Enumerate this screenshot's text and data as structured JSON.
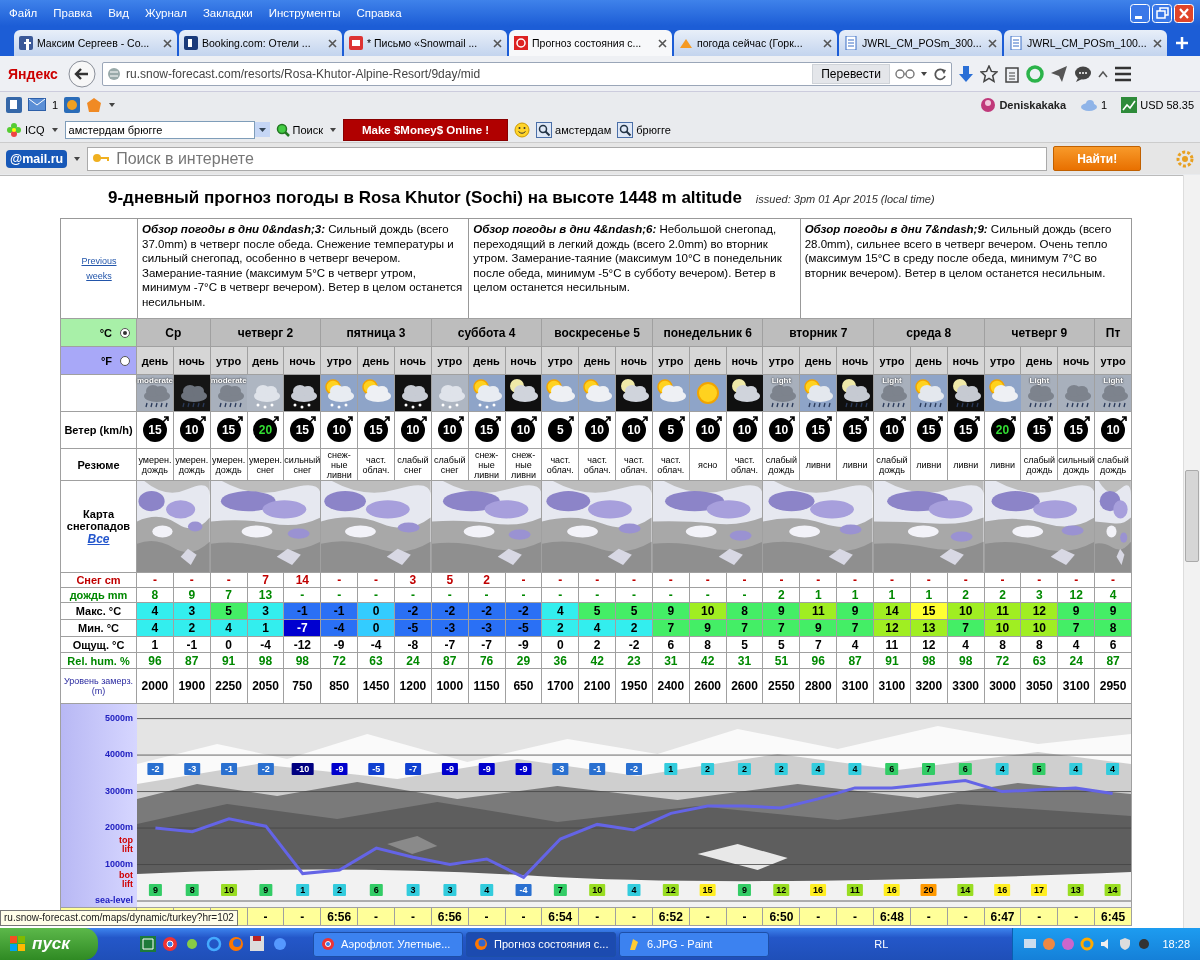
{
  "window": {
    "menu": [
      "Файл",
      "Правка",
      "Вид",
      "Журнал",
      "Закладки",
      "Инструменты",
      "Справка"
    ]
  },
  "tabs": [
    {
      "label": "Максим Сергеев - Co...",
      "selected": false
    },
    {
      "label": "Booking.com: Отели ...",
      "selected": false
    },
    {
      "label": "* Письмо «Snowmail ...",
      "selected": false
    },
    {
      "label": "Прогноз состояния с...",
      "selected": true
    },
    {
      "label": "погода сейчас (Горк...",
      "selected": false
    },
    {
      "label": "JWRL_CM_POSm_300...",
      "selected": false
    },
    {
      "label": "JWRL_CM_POSm_100...",
      "selected": false
    }
  ],
  "address_bar": {
    "logo": "Яндекс",
    "url": "ru.snow-forecast.com/resorts/Rosa-Khutor-Alpine-Resort/9day/mid",
    "translate_button": "Перевести"
  },
  "toolbar": {
    "mail_count": "1",
    "user": "Deniskakaka",
    "cloud_count": "1",
    "currency": "USD 58.35"
  },
  "search_toolbar": {
    "icq": "ICQ",
    "query": "амстердам брюгге",
    "search_button": "Поиск",
    "ad_button": "Make $Money$ Online !",
    "links": [
      "амстердам",
      "брюгге"
    ]
  },
  "mail_bar": {
    "logo": "@mail.ru",
    "placeholder": "Поиск в интернете",
    "button": "Найти!"
  },
  "page": {
    "title": "9-дневный прогноз погоды в Rosa Khutor (Sochi) на высоте 1448 m altitude",
    "issued": "issued: 3pm 01 Apr 2015 (local time)",
    "previous_link": "Previous weeks",
    "summaries": [
      "**Обзор погоды в дни 0&ndash;3:** Сильный дождь (всего 37.0mm) в четверг после обеда. Снежение температуры и сильный снегопад, особенно в четверг вечером. Замерание-таяние (максимум 5°C в четверг утром, минимум -7°C в четверг вечером). Ветер в целом останется несильным.",
      "**Обзор погоды в дни 4&ndash;6:** Небольшой снегопад, переходящий в легкий дождь (всего 2.0mm) во вторник утром. Замерание-таяние (максимум 10°C в понедельник после обеда, минимум -5°C в субботу вечером). Ветер в целом останется несильным.",
      "**Обзор погоды в дни 7&ndash;9:** Сильный дождь (всего 28.0mm), сильнее всего в четверг вечером. Очень тепло (максимум 15°C в среду после обеда, минимум 7°C во вторник вечером). Ветер в целом останется несильным."
    ]
  },
  "forecast": {
    "units": [
      {
        "label": "°C",
        "selected": true
      },
      {
        "label": "°F",
        "selected": false
      }
    ],
    "days": [
      {
        "name": "Ср",
        "periods": [
          "день",
          "ночь"
        ]
      },
      {
        "name": "четверг 2",
        "periods": [
          "утро",
          "день",
          "ночь"
        ]
      },
      {
        "name": "пятница 3",
        "periods": [
          "утро",
          "день",
          "ночь"
        ]
      },
      {
        "name": "суббота 4",
        "periods": [
          "утро",
          "день",
          "ночь"
        ]
      },
      {
        "name": "воскресенье 5",
        "periods": [
          "утро",
          "день",
          "ночь"
        ]
      },
      {
        "name": "понедельник 6",
        "periods": [
          "утро",
          "день",
          "ночь"
        ]
      },
      {
        "name": "вторник 7",
        "periods": [
          "утро",
          "день",
          "ночь"
        ]
      },
      {
        "name": "среда 8",
        "periods": [
          "утро",
          "день",
          "ночь"
        ]
      },
      {
        "name": "четверг 9",
        "periods": [
          "утро",
          "день",
          "ночь"
        ]
      },
      {
        "name": "Пт",
        "periods": [
          "утро"
        ]
      }
    ],
    "weather_icons": [
      {
        "kind": "rain",
        "caption": "moderate"
      },
      {
        "kind": "rain-night"
      },
      {
        "kind": "rain",
        "caption": "moderate"
      },
      {
        "kind": "snow"
      },
      {
        "kind": "snow-night"
      },
      {
        "kind": "sun-cloud-snow"
      },
      {
        "kind": "sun-cloud"
      },
      {
        "kind": "snow-night"
      },
      {
        "kind": "snow"
      },
      {
        "kind": "sun-cloud-snow"
      },
      {
        "kind": "moon-cloud"
      },
      {
        "kind": "sun-cloud"
      },
      {
        "kind": "sun-cloud"
      },
      {
        "kind": "moon-cloud"
      },
      {
        "kind": "sun-cloud"
      },
      {
        "kind": "sun"
      },
      {
        "kind": "moon-cloud"
      },
      {
        "kind": "rain",
        "caption": "Light"
      },
      {
        "kind": "sun-cloud-rain"
      },
      {
        "kind": "moon-rain"
      },
      {
        "kind": "rain",
        "caption": "Light"
      },
      {
        "kind": "sun-cloud-rain"
      },
      {
        "kind": "moon-rain"
      },
      {
        "kind": "sun-cloud"
      },
      {
        "kind": "rain",
        "caption": "Light"
      },
      {
        "kind": "rain"
      },
      {
        "kind": "rain",
        "caption": "Light"
      }
    ],
    "wind": {
      "label": "Ветер (km/h)",
      "values": [
        {
          "speed": "15",
          "strong": false
        },
        {
          "speed": "10",
          "strong": false
        },
        {
          "speed": "15",
          "strong": false
        },
        {
          "speed": "20",
          "strong": true
        },
        {
          "speed": "15",
          "strong": false
        },
        {
          "speed": "10",
          "strong": false
        },
        {
          "speed": "15",
          "strong": false
        },
        {
          "speed": "10",
          "strong": false
        },
        {
          "speed": "10",
          "strong": false
        },
        {
          "speed": "15",
          "strong": false
        },
        {
          "speed": "10",
          "strong": false
        },
        {
          "speed": "5",
          "strong": false
        },
        {
          "speed": "10",
          "strong": false
        },
        {
          "speed": "10",
          "strong": false
        },
        {
          "speed": "5",
          "strong": false
        },
        {
          "speed": "10",
          "strong": false
        },
        {
          "speed": "10",
          "strong": false
        },
        {
          "speed": "10",
          "strong": false
        },
        {
          "speed": "15",
          "strong": false
        },
        {
          "speed": "15",
          "strong": false
        },
        {
          "speed": "10",
          "strong": false
        },
        {
          "speed": "15",
          "strong": false
        },
        {
          "speed": "15",
          "strong": false
        },
        {
          "speed": "20",
          "strong": true
        },
        {
          "speed": "15",
          "strong": false
        },
        {
          "speed": "15",
          "strong": false
        },
        {
          "speed": "10",
          "strong": false
        }
      ]
    },
    "summary": {
      "label": "Резюме",
      "values": [
        "умерен. дождь",
        "умерен. дождь",
        "умерен. дождь",
        "умерен. снег",
        "сильный снег",
        "снеж-ные ливни",
        "част. облач.",
        "слабый снег",
        "слабый снег",
        "снеж-ные ливни",
        "снеж-ные ливни",
        "част. облач.",
        "част. облач.",
        "част. облач.",
        "част. облач.",
        "ясно",
        "част. облач.",
        "слабый дождь",
        "ливни",
        "ливни",
        "слабый дождь",
        "ливни",
        "ливни",
        "ливни",
        "слабый дождь",
        "сильный дождь",
        "слабый дождь"
      ]
    },
    "snow_maps": {
      "label": "Карта снегопадов",
      "link": "Все"
    },
    "snow": {
      "label": "Снег cm",
      "values": [
        "-",
        "-",
        "-",
        "7",
        "14",
        "-",
        "-",
        "3",
        "5",
        "2",
        "-",
        "-",
        "-",
        "-",
        "-",
        "-",
        "-",
        "-",
        "-",
        "-",
        "-",
        "-",
        "-",
        "-",
        "-",
        "-",
        "-"
      ]
    },
    "rain": {
      "label": "дождь mm",
      "values": [
        "8",
        "9",
        "7",
        "13",
        "-",
        "-",
        "-",
        "-",
        "-",
        "-",
        "-",
        "-",
        "-",
        "-",
        "-",
        "-",
        "-",
        "2",
        "1",
        "1",
        "1",
        "1",
        "2",
        "2",
        "3",
        "12",
        "4"
      ]
    },
    "max_temp": {
      "label": "Макс. °C",
      "values": [
        {
          "value": "4",
          "color": "#33eeee"
        },
        {
          "value": "3",
          "color": "#33eeee"
        },
        {
          "value": "5",
          "color": "#44ee66"
        },
        {
          "value": "3",
          "color": "#33eeee"
        },
        {
          "value": "-1",
          "color": "#2a70f5"
        },
        {
          "value": "-1",
          "color": "#2a70f5"
        },
        {
          "value": "0",
          "color": "#33ccff"
        },
        {
          "value": "-2",
          "color": "#2a70f5"
        },
        {
          "value": "-2",
          "color": "#2a70f5"
        },
        {
          "value": "-2",
          "color": "#2a70f5"
        },
        {
          "value": "-2",
          "color": "#2a70f5"
        },
        {
          "value": "4",
          "color": "#33eeee"
        },
        {
          "value": "5",
          "color": "#44ee66"
        },
        {
          "value": "5",
          "color": "#44ee66"
        },
        {
          "value": "9",
          "color": "#44ee66"
        },
        {
          "value": "10",
          "color": "#a0ee22"
        },
        {
          "value": "8",
          "color": "#44ee66"
        },
        {
          "value": "9",
          "color": "#44ee66"
        },
        {
          "value": "11",
          "color": "#a0ee22"
        },
        {
          "value": "9",
          "color": "#44ee66"
        },
        {
          "value": "14",
          "color": "#a0ee22"
        },
        {
          "value": "15",
          "color": "#ffff33"
        },
        {
          "value": "10",
          "color": "#a0ee22"
        },
        {
          "value": "11",
          "color": "#a0ee22"
        },
        {
          "value": "12",
          "color": "#a0ee22"
        },
        {
          "value": "9",
          "color": "#44ee66"
        },
        {
          "value": "9",
          "color": "#44ee66"
        }
      ]
    },
    "min_temp": {
      "label": "Мин. °C",
      "values": [
        {
          "value": "4",
          "color": "#33eeee"
        },
        {
          "value": "2",
          "color": "#33eeee"
        },
        {
          "value": "4",
          "color": "#33eeee"
        },
        {
          "value": "1",
          "color": "#33eeee"
        },
        {
          "value": "-7",
          "color": "#0000d0"
        },
        {
          "value": "-4",
          "color": "#2a70f5"
        },
        {
          "value": "0",
          "color": "#33ccff"
        },
        {
          "value": "-5",
          "color": "#2a70f5"
        },
        {
          "value": "-3",
          "color": "#2a70f5"
        },
        {
          "value": "-3",
          "color": "#2a70f5"
        },
        {
          "value": "-5",
          "color": "#2a70f5"
        },
        {
          "value": "2",
          "color": "#33eeee"
        },
        {
          "value": "4",
          "color": "#33eeee"
        },
        {
          "value": "2",
          "color": "#33eeee"
        },
        {
          "value": "7",
          "color": "#44ee66"
        },
        {
          "value": "9",
          "color": "#44ee66"
        },
        {
          "value": "7",
          "color": "#44ee66"
        },
        {
          "value": "7",
          "color": "#44ee66"
        },
        {
          "value": "9",
          "color": "#44ee66"
        },
        {
          "value": "7",
          "color": "#44ee66"
        },
        {
          "value": "12",
          "color": "#a0ee22"
        },
        {
          "value": "13",
          "color": "#a0ee22"
        },
        {
          "value": "7",
          "color": "#44ee66"
        },
        {
          "value": "10",
          "color": "#a0ee22"
        },
        {
          "value": "10",
          "color": "#a0ee22"
        },
        {
          "value": "7",
          "color": "#44ee66"
        },
        {
          "value": "8",
          "color": "#44ee66"
        }
      ]
    },
    "feels_like": {
      "label": "Ощущ. °C",
      "values": [
        "1",
        "-1",
        "0",
        "-4",
        "-12",
        "-9",
        "-4",
        "-8",
        "-7",
        "-7",
        "-9",
        "0",
        "2",
        "-2",
        "6",
        "8",
        "5",
        "5",
        "7",
        "4",
        "11",
        "12",
        "4",
        "8",
        "8",
        "4",
        "6"
      ]
    },
    "humidity": {
      "label": "Rel. hum. %",
      "values": [
        "96",
        "87",
        "91",
        "98",
        "98",
        "72",
        "63",
        "24",
        "87",
        "76",
        "29",
        "36",
        "42",
        "23",
        "31",
        "42",
        "31",
        "51",
        "96",
        "87",
        "91",
        "98",
        "98",
        "72",
        "63",
        "24",
        "87"
      ]
    },
    "freezing_level": {
      "label": "Уровень замерз. (m)",
      "values": [
        "2000",
        "1900",
        "2250",
        "2050",
        "750",
        "850",
        "1450",
        "1200",
        "1000",
        "1150",
        "650",
        "1700",
        "2100",
        "1950",
        "2400",
        "2600",
        "2600",
        "2550",
        "2800",
        "3100",
        "3100",
        "3200",
        "3300",
        "3000",
        "3050",
        "3100",
        "2950"
      ]
    },
    "freezing_chart": {
      "chart_data": {
        "type": "line",
        "values": [
          2000,
          1900,
          2250,
          2050,
          750,
          850,
          1450,
          1200,
          1000,
          1150,
          650,
          1700,
          2100,
          1950,
          2400,
          2600,
          2600,
          2550,
          2800,
          3100,
          3100,
          3200,
          3300,
          3000,
          3050,
          3100,
          2950
        ],
        "ylim": [
          0,
          5400
        ],
        "yticks": [
          {
            "value": 5000,
            "label": "5000m"
          },
          {
            "value": 4000,
            "label": "4000m"
          },
          {
            "value": 3000,
            "label": "3000m"
          },
          {
            "value": 2000,
            "label": "2000m"
          },
          {
            "value": 1000,
            "label": "1000m"
          },
          {
            "value": 0,
            "label": "sea-level"
          }
        ],
        "annotations": [
          "top lift",
          "bot lift"
        ],
        "grid": true,
        "categories": [
          null,
          null,
          null,
          null,
          null,
          null,
          null,
          null,
          null,
          null,
          null,
          null,
          null,
          null,
          null,
          null,
          null,
          null,
          null,
          null,
          null,
          null,
          null,
          null,
          null,
          null,
          null
        ]
      },
      "top_lift_temps": [
        {
          "value": "-2",
          "color": "#2a70d0"
        },
        {
          "value": "-3",
          "color": "#2a70d0"
        },
        {
          "value": "-1",
          "color": "#2a70d0"
        },
        {
          "value": "-2",
          "color": "#2a70d0"
        },
        {
          "value": "-10",
          "color": "#000080"
        },
        {
          "value": "-9",
          "color": "#0000cc"
        },
        {
          "value": "-5",
          "color": "#1040d0"
        },
        {
          "value": "-7",
          "color": "#1040d0"
        },
        {
          "value": "-9",
          "color": "#0000cc"
        },
        {
          "value": "-9",
          "color": "#0000cc"
        },
        {
          "value": "-9",
          "color": "#0000cc"
        },
        {
          "value": "-3",
          "color": "#2a70d0"
        },
        {
          "value": "-1",
          "color": "#2a70d0"
        },
        {
          "value": "-2",
          "color": "#2a70d0"
        },
        {
          "value": "1",
          "color": "#33ccdd"
        },
        {
          "value": "2",
          "color": "#33ccdd"
        },
        {
          "value": "2",
          "color": "#33ccdd"
        },
        {
          "value": "2",
          "color": "#33ccdd"
        },
        {
          "value": "4",
          "color": "#33ccdd"
        },
        {
          "value": "4",
          "color": "#33ccdd"
        },
        {
          "value": "6",
          "color": "#33cc66"
        },
        {
          "value": "7",
          "color": "#33cc66"
        },
        {
          "value": "6",
          "color": "#33cc66"
        },
        {
          "value": "4",
          "color": "#33ccdd"
        },
        {
          "value": "5",
          "color": "#33cc66"
        },
        {
          "value": "4",
          "color": "#33ccdd"
        },
        {
          "value": "4",
          "color": "#33ccdd"
        }
      ],
      "bot_lift_temps": [
        {
          "value": "9",
          "color": "#33cc66"
        },
        {
          "value": "8",
          "color": "#33cc66"
        },
        {
          "value": "10",
          "color": "#99dd22"
        },
        {
          "value": "9",
          "color": "#33cc66"
        },
        {
          "value": "1",
          "color": "#33ccdd"
        },
        {
          "value": "2",
          "color": "#33ccdd"
        },
        {
          "value": "6",
          "color": "#33cc66"
        },
        {
          "value": "3",
          "color": "#33ccdd"
        },
        {
          "value": "3",
          "color": "#33ccdd"
        },
        {
          "value": "4",
          "color": "#33ccdd"
        },
        {
          "value": "-4",
          "color": "#2a70d0"
        },
        {
          "value": "7",
          "color": "#33cc66"
        },
        {
          "value": "10",
          "color": "#99dd22"
        },
        {
          "value": "4",
          "color": "#33ccdd"
        },
        {
          "value": "12",
          "color": "#99dd22"
        },
        {
          "value": "15",
          "color": "#ffee22"
        },
        {
          "value": "9",
          "color": "#33cc66"
        },
        {
          "value": "12",
          "color": "#99dd22"
        },
        {
          "value": "16",
          "color": "#ffee22"
        },
        {
          "value": "11",
          "color": "#99dd22"
        },
        {
          "value": "16",
          "color": "#ffee22"
        },
        {
          "value": "20",
          "color": "#ff9900"
        },
        {
          "value": "14",
          "color": "#99dd22"
        },
        {
          "value": "16",
          "color": "#ffee22"
        },
        {
          "value": "17",
          "color": "#ffee22"
        },
        {
          "value": "13",
          "color": "#99dd22"
        },
        {
          "value": "14",
          "color": "#99dd22"
        }
      ]
    },
    "sunrise": [
      "-",
      "-",
      "6:56",
      "-",
      "-",
      "6:56",
      "-",
      "-",
      "6:54",
      "-",
      "-",
      "6:52",
      "-",
      "-",
      "6:50",
      "-",
      "-",
      "6:48",
      "-",
      "-",
      "6:47",
      "-",
      "-",
      "6:45"
    ]
  },
  "status_url": "ru.snow-forecast.com/maps/dynamic/turkey?hr=102",
  "taskbar": {
    "start": "пуск",
    "tasks": [
      {
        "label": "Аэрофлот. Улетные...",
        "selected": false
      },
      {
        "label": "Прогноз состояния с...",
        "selected": true
      },
      {
        "label": "6.JPG - Paint",
        "selected": false
      }
    ],
    "language": "RL",
    "clock": "18:28"
  }
}
